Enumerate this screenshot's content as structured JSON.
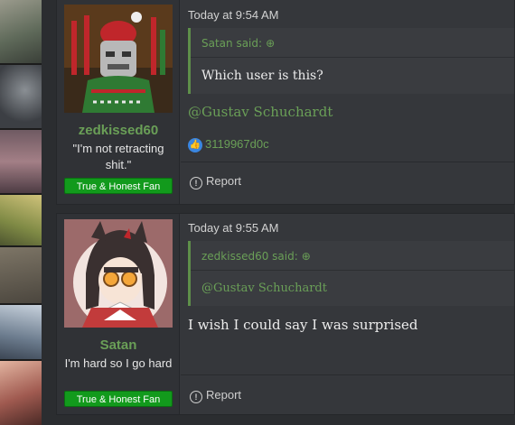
{
  "posts": [
    {
      "username": "zedkissed60",
      "user_title": "\"I'm not retracting shit.\"",
      "banner": "True & Honest Fan",
      "timestamp": "Today at 9:54 AM",
      "quote": {
        "author": "Satan said:",
        "text": "Which user is this?"
      },
      "mention": "@Gustav Schuchardt",
      "reaction_user": "3119967d0c",
      "report": "Report"
    },
    {
      "username": "Satan",
      "user_title": "I'm hard so I go hard",
      "banner": "True & Honest Fan",
      "timestamp": "Today at 9:55 AM",
      "quote": {
        "author": "zedkissed60 said:",
        "text": "@Gustav Schuchardt"
      },
      "body": "I wish I could say I was surprised",
      "report": "Report"
    }
  ],
  "icons": {
    "quote_arrow": "arrow-up-circle-icon",
    "like": "like-icon",
    "report": "report-icon"
  },
  "colors": {
    "accent": "#6a9f57",
    "banner": "#129a1c",
    "like": "#3a86e0"
  }
}
